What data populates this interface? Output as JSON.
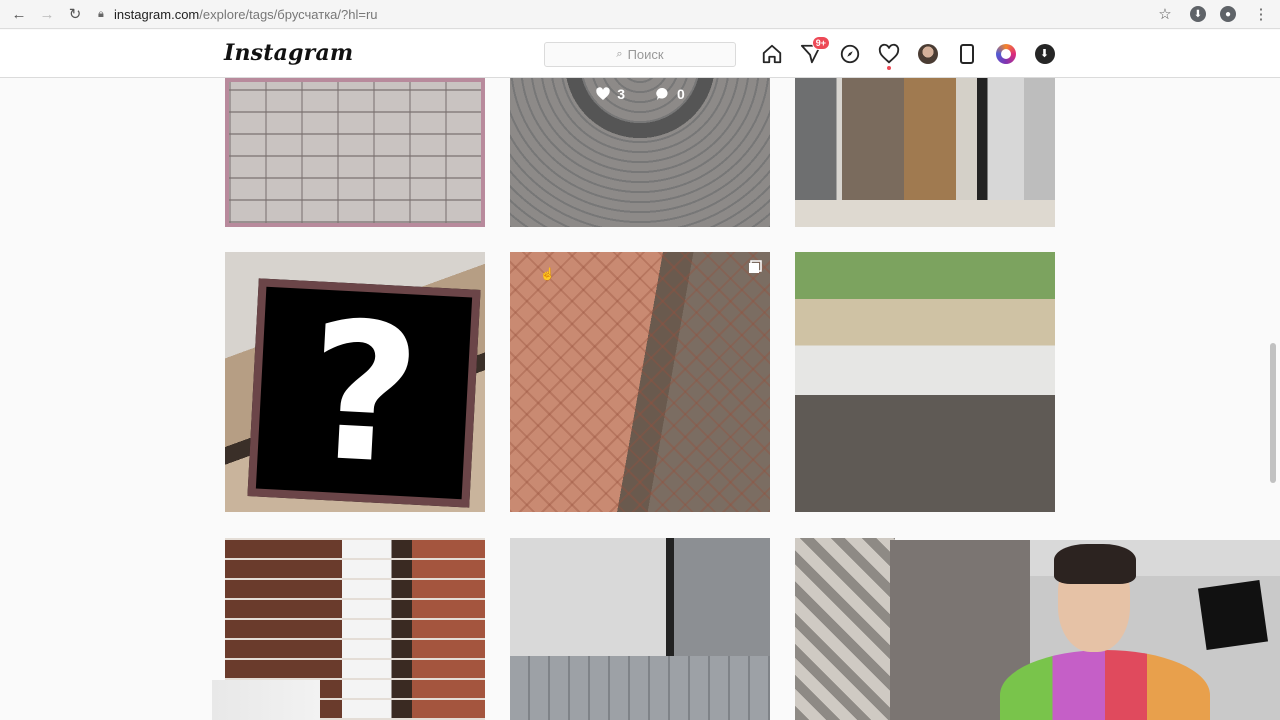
{
  "browser": {
    "url_host": "instagram.com",
    "url_path": "/explore/tags/брусчатка/?hl=ru",
    "icons": [
      "back-icon",
      "forward-icon",
      "reload-icon",
      "lock-icon",
      "star-icon",
      "extension-icon",
      "account-icon",
      "menu-icon"
    ]
  },
  "header": {
    "logo": "Instagram",
    "search_placeholder": "Поиск",
    "notification_badge": "9+",
    "icons": [
      "home-icon",
      "direct-icon",
      "explore-icon",
      "heart-icon",
      "avatar",
      "mobile-icon",
      "story-icon",
      "download-icon"
    ]
  },
  "posts": [
    {
      "name": "post-pavers-herringbone"
    },
    {
      "name": "post-pavers-circle",
      "likes": "3",
      "comments": "0"
    },
    {
      "name": "post-interior-hall"
    },
    {
      "name": "post-question-sign",
      "sign_text": "?"
    },
    {
      "name": "post-brick-path"
    },
    {
      "name": "post-wall-construction"
    },
    {
      "name": "post-brick-facade"
    },
    {
      "name": "post-gutter-pavers"
    },
    {
      "name": "post-tiled-room"
    }
  ],
  "colors": {
    "accent_badge": "#ed4956",
    "background": "#fafafa",
    "header_border": "#dbdbdb"
  }
}
